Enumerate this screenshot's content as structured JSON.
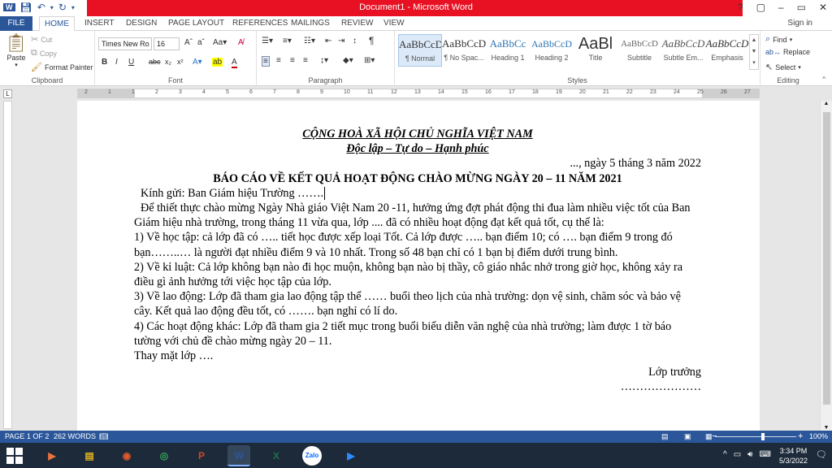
{
  "window": {
    "title": "Document1 - Microsoft Word",
    "controls": [
      "?",
      "▢",
      "–",
      "▭",
      "✕"
    ]
  },
  "tabs": {
    "file": "FILE",
    "items": [
      "HOME",
      "INSERT",
      "DESIGN",
      "PAGE LAYOUT",
      "REFERENCES",
      "MAILINGS",
      "REVIEW",
      "VIEW"
    ],
    "active": "HOME",
    "signin": "Sign in"
  },
  "ribbon": {
    "clipboard": {
      "paste": "Paste",
      "cut": "Cut",
      "copy": "Copy",
      "format_painter": "Format Painter",
      "label": "Clipboard"
    },
    "font": {
      "name": "Times New Ro",
      "size": "16",
      "label": "Font",
      "bold": "B",
      "italic": "I",
      "underline": "U",
      "strike": "abc",
      "sub": "x₂",
      "sup": "x²"
    },
    "paragraph": {
      "label": "Paragraph"
    },
    "styles": {
      "label": "Styles",
      "items": [
        {
          "preview": "AaBbCcDc",
          "name": "¶ Normal"
        },
        {
          "preview": "AaBbCcDc",
          "name": "¶ No Spac..."
        },
        {
          "preview": "AaBbCc",
          "name": "Heading 1"
        },
        {
          "preview": "AaBbCcD",
          "name": "Heading 2"
        },
        {
          "preview": "AaBl",
          "name": "Title"
        },
        {
          "preview": "AaBbCcD",
          "name": "Subtitle"
        },
        {
          "preview": "AaBbCcD",
          "name": "Subtle Em..."
        },
        {
          "preview": "AaBbCcD",
          "name": "Emphasis"
        }
      ]
    },
    "editing": {
      "find": "Find",
      "replace": "Replace",
      "select": "Select",
      "label": "Editing"
    }
  },
  "ruler": {
    "ticks": [
      "2",
      "1",
      "1",
      "2",
      "3",
      "4",
      "5",
      "6",
      "7",
      "8",
      "9",
      "10",
      "11",
      "12",
      "13",
      "14",
      "15",
      "16",
      "17",
      "18",
      "19",
      "20",
      "21",
      "22",
      "23",
      "24",
      "25",
      "26",
      "27"
    ]
  },
  "document": {
    "heading1": "CỘNG HOÀ XÃ HỘI CHỦ NGHĨA VIỆT NAM",
    "heading2": "Độc lập – Tự do – Hạnh phúc",
    "date": "..., ngày 5 tháng 3 năm 2022",
    "report_title": "BÁO CÁO VỀ KẾT QUẢ HOẠT ĐỘNG CHÀO MỪNG NGÀY 20 – 11 NĂM 2021",
    "greeting": "Kính gửi: Ban Giám hiệu Trường …….",
    "intro": "Để thiết thực chào mừng Ngày Nhà giáo Việt Nam 20 -11, hưởng ứng đợt phát động thi đua làm nhiều việc tốt của Ban Giám hiệu nhà trường, trong tháng 11 vừa qua, lớp .... đã có nhiều hoạt động đạt kết quả tốt, cụ thể là:",
    "p1": "1) Về học tập: cả lớp đã có ….. tiết học được xếp loại Tốt. Cả lớp được ….. bạn điểm 10; có …. bạn điểm 9 trong đó bạn……..…  là người đạt nhiều điểm 9 và 10 nhất. Trong số 48 bạn chỉ có 1 bạn bị điểm dưới trung bình.",
    "p2": "2) Về kỉ luật: Cả lớp không bạn nào đi học muộn, không bạn nào bị thầy, cô giáo nhắc nhở trong giờ học, không xảy ra điều gì ảnh hưởng tới việc học tập của lớp.",
    "p3": "3) Về lao động: Lớp đã tham gia lao động tập thể …… buổi theo lịch của nhà trường: dọn vệ sinh, chăm sóc và bảo vệ cây. Kết quả lao động đều tốt, có ……. bạn nghỉ có lí do.",
    "p4": "4) Các hoạt động khác: Lớp đã tham gia 2 tiết mục trong buổi biểu diễn văn nghệ của nhà trường; làm được 1 tờ báo tường với chủ đề chào mừng ngày 20 – 11.",
    "closing": "Thay mặt lớp ….",
    "signer": "Lớp trưởng",
    "dots": "…………………"
  },
  "status": {
    "page": "PAGE 1 OF 2",
    "words": "262 WORDS",
    "zoom": "100%"
  },
  "taskbar": {
    "apps": [
      {
        "name": "media-player",
        "glyph": "▶",
        "color": "#e8743b"
      },
      {
        "name": "file-explorer",
        "glyph": "▤",
        "color": "#e6b422"
      },
      {
        "name": "media-app",
        "glyph": "◉",
        "color": "#e05a2a"
      },
      {
        "name": "chrome",
        "glyph": "◎",
        "color": "#34a853"
      },
      {
        "name": "powerpoint",
        "glyph": "P",
        "color": "#d24726"
      },
      {
        "name": "word",
        "glyph": "W",
        "color": "#2b579a"
      },
      {
        "name": "excel",
        "glyph": "X",
        "color": "#217346"
      },
      {
        "name": "zalo",
        "glyph": "Zalo",
        "color": "#0068ff"
      },
      {
        "name": "zoom",
        "glyph": "▶",
        "color": "#2d8cff"
      }
    ],
    "time": "3:34 PM",
    "date": "5/3/2022"
  },
  "colors": {
    "accent": "#2b579a",
    "titlebar_red": "#e81123"
  }
}
